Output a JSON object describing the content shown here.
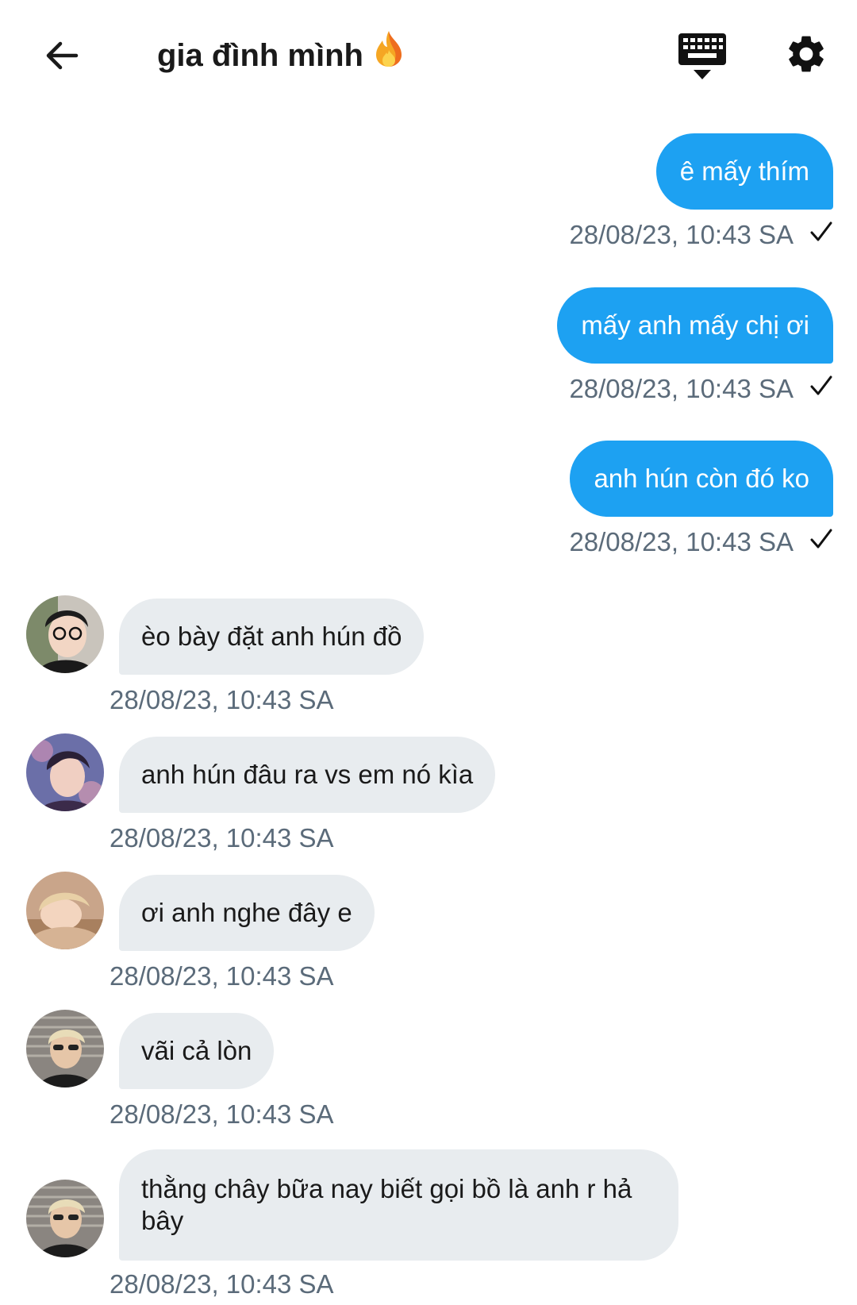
{
  "header": {
    "title": "gia đình mình",
    "back_icon": "arrow-left-icon",
    "title_emoji": "fire-icon",
    "keyboard_icon": "keyboard-hide-icon",
    "settings_icon": "gear-icon"
  },
  "colors": {
    "outgoing_bubble": "#1da1f2",
    "incoming_bubble": "#e8ecef",
    "timestamp": "#5b6b7a"
  },
  "outgoing": [
    {
      "text": "ê mấy thím",
      "time": "28/08/23, 10:43 SA"
    },
    {
      "text": "mấy anh mấy chị ơi",
      "time": "28/08/23, 10:43 SA"
    },
    {
      "text": "anh hún còn đó ko",
      "time": "28/08/23, 10:43 SA"
    }
  ],
  "incoming": [
    {
      "text": "èo bày đặt anh hún đồ",
      "time": "28/08/23, 10:43 SA"
    },
    {
      "text": "anh hún đâu ra vs em nó kìa",
      "time": "28/08/23, 10:43 SA"
    },
    {
      "text": "ơi anh nghe đây e",
      "time": "28/08/23, 10:43 SA"
    },
    {
      "text": "vãi cả lòn",
      "time": "28/08/23, 10:43 SA"
    },
    {
      "text": "thằng chây bữa nay biết gọi bồ là anh r hả bây",
      "time": "28/08/23, 10:43 SA"
    }
  ]
}
